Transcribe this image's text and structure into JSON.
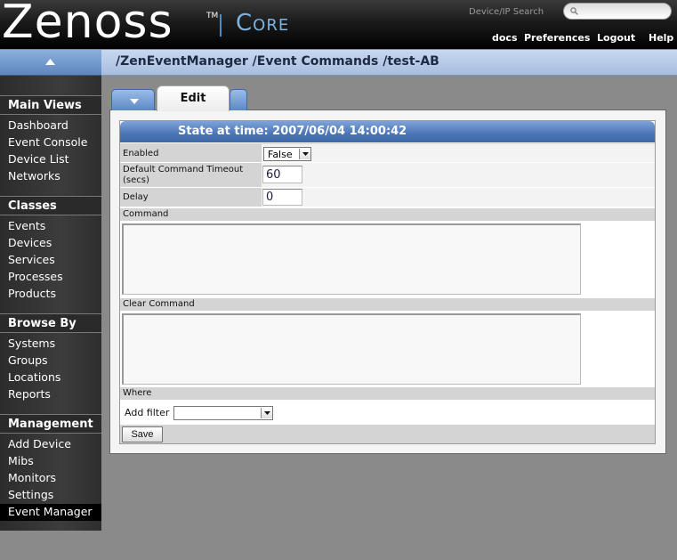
{
  "header": {
    "logo": "Zenoss",
    "trademark": "TM",
    "product": "Core",
    "search_label": "Device/IP Search",
    "search_placeholder": "",
    "links": [
      "docs",
      "Preferences",
      "Logout",
      "Help"
    ]
  },
  "breadcrumb": "/ZenEventManager /Event Commands /test-AB",
  "sidebar": {
    "sections": [
      {
        "title": "Main Views",
        "items": [
          "Dashboard",
          "Event Console",
          "Device List",
          "Networks"
        ]
      },
      {
        "title": "Classes",
        "items": [
          "Events",
          "Devices",
          "Services",
          "Processes",
          "Products"
        ]
      },
      {
        "title": "Browse By",
        "items": [
          "Systems",
          "Groups",
          "Locations",
          "Reports"
        ]
      },
      {
        "title": "Management",
        "items": [
          "Add Device",
          "Mibs",
          "Monitors",
          "Settings",
          "Event Manager"
        ]
      }
    ],
    "active_item": "Event Manager"
  },
  "tabs": {
    "active": "Edit"
  },
  "form": {
    "title": "State at time: 2007/06/04 14:00:42",
    "enabled_label": "Enabled",
    "enabled_value": "False",
    "timeout_label": "Default Command Timeout (secs)",
    "timeout_value": "60",
    "delay_label": "Delay",
    "delay_value": "0",
    "command_label": "Command",
    "command_value": "",
    "clear_command_label": "Clear Command",
    "clear_command_value": "",
    "where_label": "Where",
    "add_filter_label": "Add filter",
    "add_filter_value": "",
    "save_label": "Save"
  },
  "colors": {
    "header_bg": "#000000",
    "accent_blue": "#4a75b5",
    "crumb_bar": "#b6c9e6",
    "sidebar_bg": "#333333",
    "page_bg": "#8a8a8a"
  }
}
